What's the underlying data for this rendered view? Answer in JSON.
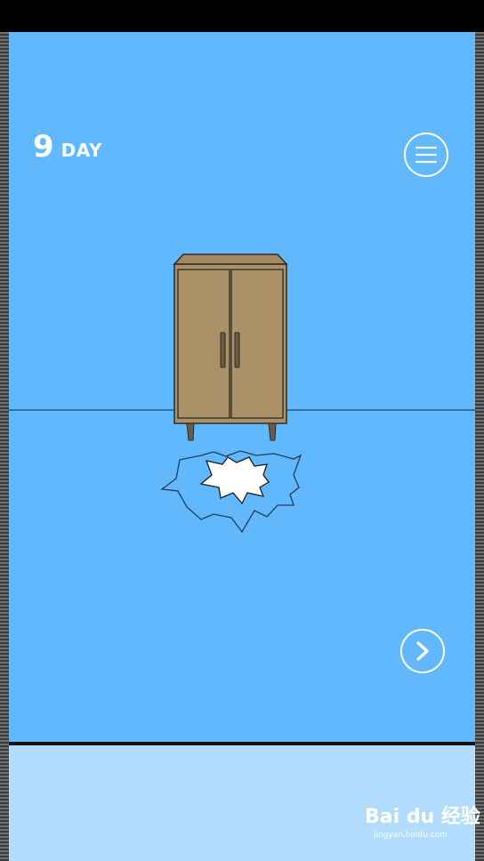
{
  "hud": {
    "day_number": "9",
    "day_label": "DAY",
    "menu_icon": "menu-icon",
    "next_icon": "chevron-right-icon"
  },
  "scene": {
    "objects": [
      "wooden-cabinet",
      "hole-in-floor"
    ]
  },
  "colors": {
    "sky_blue": "#62b8fd",
    "panel_light_blue": "#b1dcfe",
    "cabinet_wood": "#ab9167",
    "hole_white": "#ffffff"
  },
  "watermark": {
    "brand": "Bai du 经验",
    "url": "jingyan.baidu.com"
  }
}
